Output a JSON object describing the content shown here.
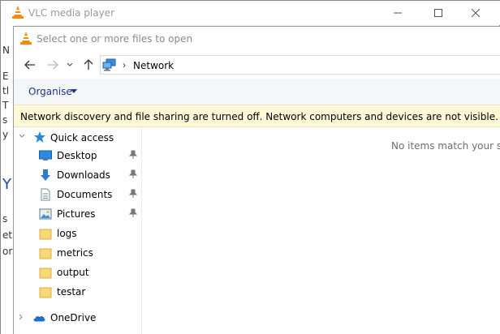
{
  "vlc": {
    "title": "VLC media player",
    "peek_chars": [
      "N",
      "E",
      "tl",
      "T",
      "s",
      "y",
      "Y",
      "s",
      "et",
      "or"
    ]
  },
  "dialog": {
    "title": "Select one or more files to open",
    "address": {
      "location": "Network"
    },
    "toolbar": {
      "organise_label": "Organise"
    },
    "infobar": {
      "message": "Network discovery and file sharing are turned off. Network computers and devices are not visible. Click to change..."
    },
    "navpane": {
      "quick_access_label": "Quick access",
      "items": [
        {
          "label": "Desktop",
          "icon": "desktop-icon",
          "pinned": true
        },
        {
          "label": "Downloads",
          "icon": "downloads-icon",
          "pinned": true
        },
        {
          "label": "Documents",
          "icon": "documents-icon",
          "pinned": true
        },
        {
          "label": "Pictures",
          "icon": "pictures-icon",
          "pinned": true
        },
        {
          "label": "logs",
          "icon": "folder-icon",
          "pinned": false
        },
        {
          "label": "metrics",
          "icon": "folder-icon",
          "pinned": false
        },
        {
          "label": "output",
          "icon": "folder-icon",
          "pinned": false
        },
        {
          "label": "testar",
          "icon": "folder-icon",
          "pinned": false
        }
      ],
      "onedrive_label": "OneDrive"
    },
    "content": {
      "empty_message": "No items match your search."
    }
  },
  "colors": {
    "infobar_bg": "#fff8d7",
    "organise_text": "#1e3287",
    "folder_yellow": "#f8d775",
    "star_blue": "#2b88d8"
  }
}
